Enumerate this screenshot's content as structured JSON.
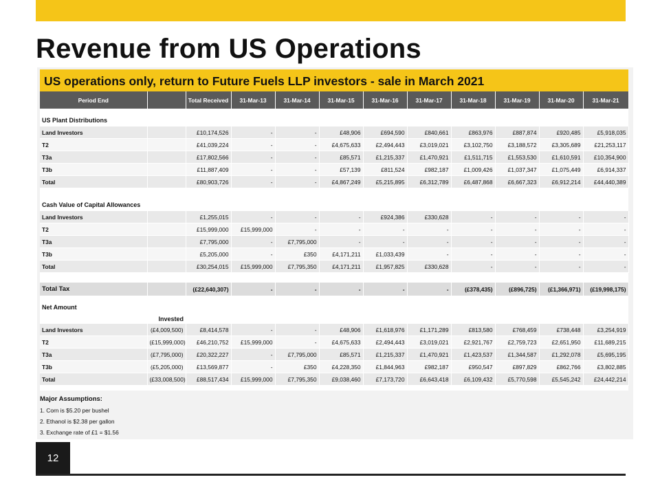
{
  "slide": {
    "title": "Revenue from US Operations",
    "table_heading": "US operations only, return to Future Fuels LLP investors - sale in March 2021",
    "page_number": "12",
    "accent_color": "#f5c518",
    "header_fill": "#5a5a5a"
  },
  "table": {
    "columns": [
      "Period End",
      "",
      "Total Received",
      "31-Mar-13",
      "31-Mar-14",
      "31-Mar-15",
      "31-Mar-16",
      "31-Mar-17",
      "31-Mar-18",
      "31-Mar-19",
      "31-Mar-20",
      "31-Mar-21"
    ],
    "us_plant": {
      "title": "US Plant Distributions",
      "rows": [
        [
          "Land Investors",
          "",
          "£10,174,526",
          "-",
          "-",
          "£48,906",
          "£694,590",
          "£840,661",
          "£863,976",
          "£887,874",
          "£920,485",
          "£5,918,035"
        ],
        [
          "T2",
          "",
          "£41,039,224",
          "-",
          "-",
          "£4,675,633",
          "£2,494,443",
          "£3,019,021",
          "£3,102,750",
          "£3,188,572",
          "£3,305,689",
          "£21,253,117"
        ],
        [
          "T3a",
          "",
          "£17,802,566",
          "-",
          "-",
          "£85,571",
          "£1,215,337",
          "£1,470,921",
          "£1,511,715",
          "£1,553,530",
          "£1,610,591",
          "£10,354,900"
        ],
        [
          "T3b",
          "",
          "£11,887,409",
          "-",
          "-",
          "£57,139",
          "£811,524",
          "£982,187",
          "£1,009,426",
          "£1,037,347",
          "£1,075,449",
          "£6,914,337"
        ],
        [
          "Total",
          "",
          "£80,903,726",
          "-",
          "-",
          "£4,867,249",
          "£5,215,895",
          "£6,312,789",
          "£6,487,868",
          "£6,667,323",
          "£6,912,214",
          "£44,440,389"
        ]
      ]
    },
    "capital_allowances": {
      "title": "Cash Value of Capital Allowances",
      "rows": [
        [
          "Land Investors",
          "",
          "£1,255,015",
          "-",
          "-",
          "-",
          "£924,386",
          "£330,628",
          "-",
          "-",
          "-",
          "-"
        ],
        [
          "T2",
          "",
          "£15,999,000",
          "£15,999,000",
          "-",
          "-",
          "-",
          "-",
          "-",
          "-",
          "-",
          "-"
        ],
        [
          "T3a",
          "",
          "£7,795,000",
          "-",
          "£7,795,000",
          "-",
          "-",
          "-",
          "-",
          "-",
          "-",
          "-"
        ],
        [
          "T3b",
          "",
          "£5,205,000",
          "-",
          "£350",
          "£4,171,211",
          "£1,033,439",
          "-",
          "-",
          "-",
          "-",
          "-"
        ],
        [
          "Total",
          "",
          "£30,254,015",
          "£15,999,000",
          "£7,795,350",
          "£4,171,211",
          "£1,957,825",
          "£330,628",
          "-",
          "-",
          "-",
          "-"
        ]
      ]
    },
    "total_tax": [
      "Total Tax",
      "",
      "(£22,640,307)",
      "-",
      "-",
      "-",
      "-",
      "-",
      "(£378,435)",
      "(£896,725)",
      "(£1,366,971)",
      "(£19,998,175)"
    ],
    "net_amount": {
      "title": "Net Amount",
      "invested_label": "Invested",
      "rows": [
        [
          "Land Investors",
          "(£4,009,500)",
          "£8,414,578",
          "-",
          "-",
          "£48,906",
          "£1,618,976",
          "£1,171,289",
          "£813,580",
          "£768,459",
          "£738,448",
          "£3,254,919"
        ],
        [
          "T2",
          "(£15,999,000)",
          "£46,210,752",
          "£15,999,000",
          "-",
          "£4,675,633",
          "£2,494,443",
          "£3,019,021",
          "£2,921,767",
          "£2,759,723",
          "£2,651,950",
          "£11,689,215"
        ],
        [
          "T3a",
          "(£7,795,000)",
          "£20,322,227",
          "-",
          "£7,795,000",
          "£85,571",
          "£1,215,337",
          "£1,470,921",
          "£1,423,537",
          "£1,344,587",
          "£1,292,078",
          "£5,695,195"
        ],
        [
          "T3b",
          "(£5,205,000)",
          "£13,569,877",
          "-",
          "£350",
          "£4,228,350",
          "£1,844,963",
          "£982,187",
          "£950,547",
          "£897,829",
          "£862,766",
          "£3,802,885"
        ],
        [
          "Total",
          "(£33,008,500)",
          "£88,517,434",
          "£15,999,000",
          "£7,795,350",
          "£9,038,460",
          "£7,173,720",
          "£6,643,418",
          "£6,109,432",
          "£5,770,598",
          "£5,545,242",
          "£24,442,214"
        ]
      ]
    }
  },
  "assumptions": {
    "title": "Major Assumptions:",
    "items": [
      "1. Corn is $5.20 per bushel",
      "2. Ethanol is $2.38 per gallon",
      "3. Exchange rate of £1 = $1.56"
    ]
  }
}
